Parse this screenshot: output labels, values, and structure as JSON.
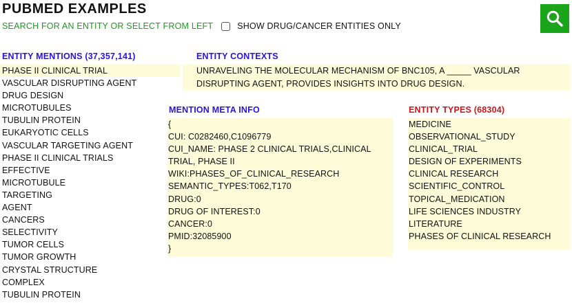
{
  "header": {
    "title": "PUBMED EXAMPLES",
    "subtitle": "SEARCH FOR AN ENTITY OR SELECT FROM LEFT",
    "checkbox_label": "SHOW DRUG/CANCER ENTITIES ONLY",
    "checkbox_checked": false,
    "search_icon": "search-icon",
    "search_button_color": "#1aa51a"
  },
  "mentions": {
    "heading": "ENTITY MENTIONS (37,357,141)",
    "items": [
      "PHASE II CLINICAL TRIAL",
      "VASCULAR DISRUPTING AGENT",
      "DRUG DESIGN",
      "MICROTUBULES",
      "TUBULIN PROTEIN",
      "EUKARYOTIC CELLS",
      "VASCULAR TARGETING AGENT",
      "PHASE II CLINICAL TRIALS",
      "EFFECTIVE",
      "MICROTUBULE",
      "TARGETING",
      "AGENT",
      "CANCERS",
      "SELECTIVITY",
      "TUMOR CELLS",
      "TUMOR GROWTH",
      "CRYSTAL STRUCTURE",
      "COMPLEX",
      "TUBULIN PROTEIN"
    ]
  },
  "contexts": {
    "heading": "ENTITY CONTEXTS",
    "line1": "UNRAVELING THE MOLECULAR MECHANISM OF BNC105, A _____ VASCULAR",
    "line2": "DISRUPTING AGENT, PROVIDES INSIGHTS INTO DRUG DESIGN."
  },
  "meta": {
    "heading": "MENTION META INFO",
    "open_brace": "{",
    "cui": "CUI: C0282460,C1096779",
    "cui_name_line1": "CUI_NAME: PHASE 2 CLINICAL TRIALS,CLINICAL",
    "cui_name_line2": "TRIAL, PHASE II",
    "wiki": "WIKI:PHASES_OF_CLINICAL_RESEARCH",
    "semantic_types": "SEMANTIC_TYPES:T062,T170",
    "drug": "DRUG:0",
    "drug_of_interest": "DRUG OF INTEREST:0",
    "cancer": "CANCER:0",
    "pmid": "PMID:32085900",
    "close_brace": "}"
  },
  "types": {
    "heading": "ENTITY TYPES (68304)",
    "items": [
      "MEDICINE",
      "OBSERVATIONAL_STUDY",
      "CLINICAL_TRIAL",
      "DESIGN OF EXPERIMENTS",
      "CLINICAL RESEARCH",
      "SCIENTIFIC_CONTROL",
      "TOPICAL_MEDICATION",
      "LIFE SCIENCES INDUSTRY",
      "LITERATURE",
      "PHASES OF CLINICAL RESEARCH"
    ]
  },
  "colors": {
    "heading_blue": "#2a14d6",
    "heading_red": "#d0141a",
    "subtitle_green": "#1e9a1e",
    "panel_background": "#fdfbd8"
  }
}
